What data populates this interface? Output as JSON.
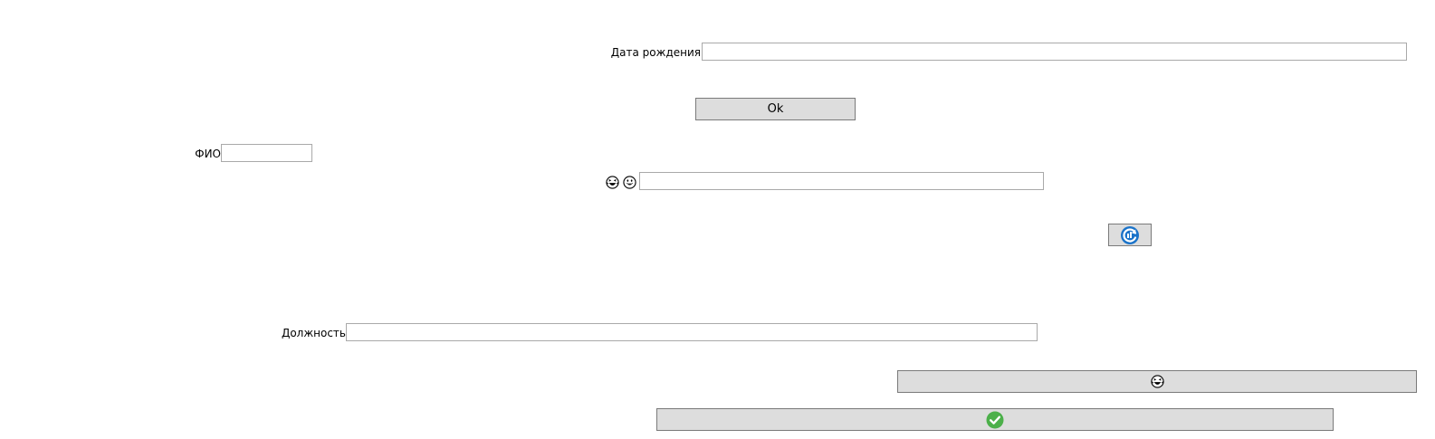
{
  "form": {
    "birth_date": {
      "label": "Дата рождения",
      "value": "",
      "placeholder": ""
    },
    "ok_button": {
      "label": "Ok"
    },
    "fio": {
      "label": "ФИО",
      "value": "",
      "placeholder": ""
    },
    "emoji_field": {
      "icons": [
        "laughing-emoji-icon",
        "grinning-emoji-icon"
      ],
      "value": "",
      "placeholder": ""
    },
    "refresh_button": {
      "icon": "blue-refresh-icon"
    },
    "position": {
      "label": "Должность",
      "value": "",
      "placeholder": ""
    },
    "emoji_button": {
      "icon": "laughing-emoji-icon"
    },
    "confirm_button": {
      "icon": "green-check-icon"
    }
  },
  "colors": {
    "button_bg": "#dddddd",
    "field_border": "#a9a9a9",
    "refresh_blue": "#1a73c9",
    "check_green": "#4cb04a"
  }
}
